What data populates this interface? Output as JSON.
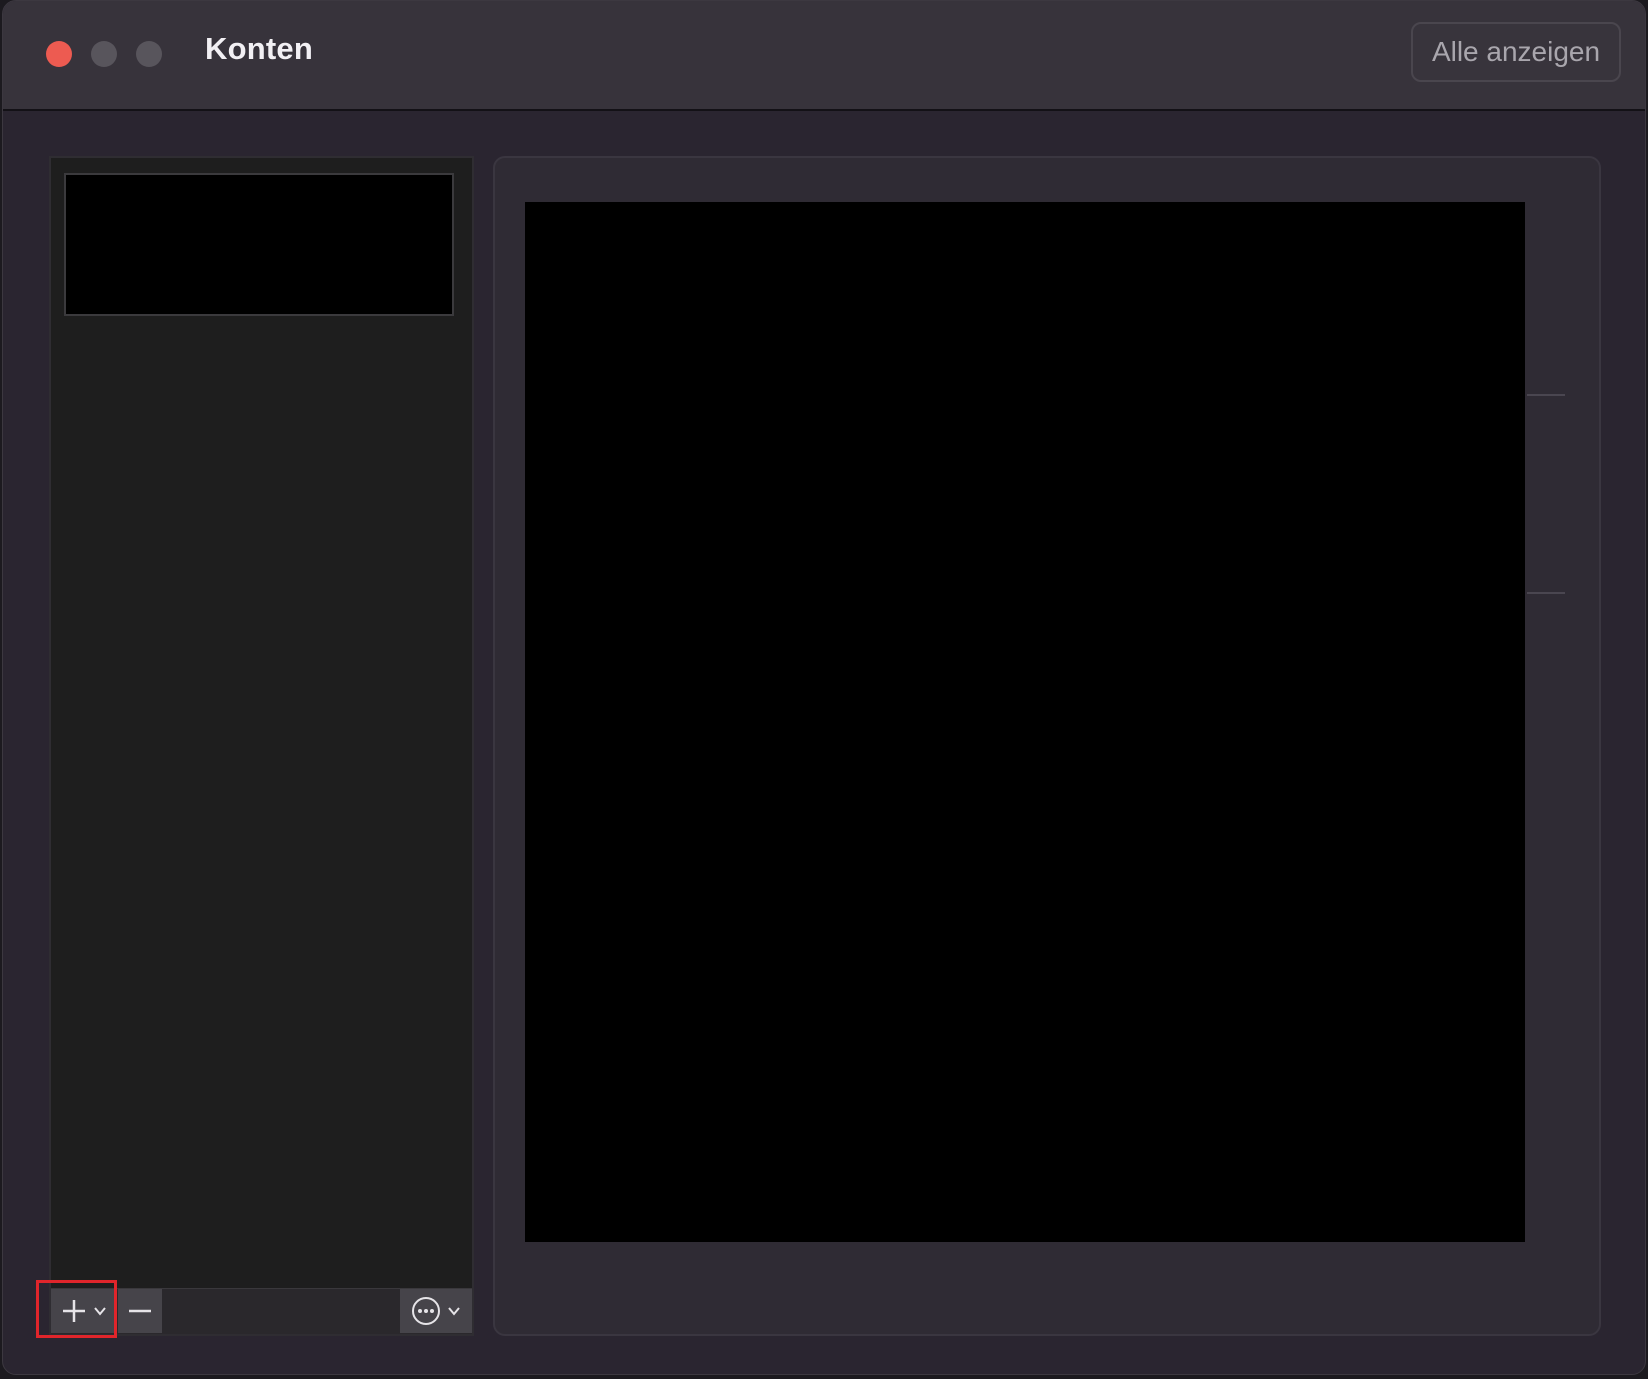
{
  "window": {
    "title": "Konten",
    "show_all_label": "Alle anzeigen"
  },
  "toolbar": {
    "add_icon": "plus-icon",
    "add_menu_icon": "chevron-down-icon",
    "remove_icon": "minus-icon",
    "more_icon": "ellipsis-circle-icon",
    "more_menu_icon": "chevron-down-icon"
  },
  "colors": {
    "close": "#ed5b51",
    "inactive_traffic": "#58555c",
    "highlight": "#e0252b"
  }
}
